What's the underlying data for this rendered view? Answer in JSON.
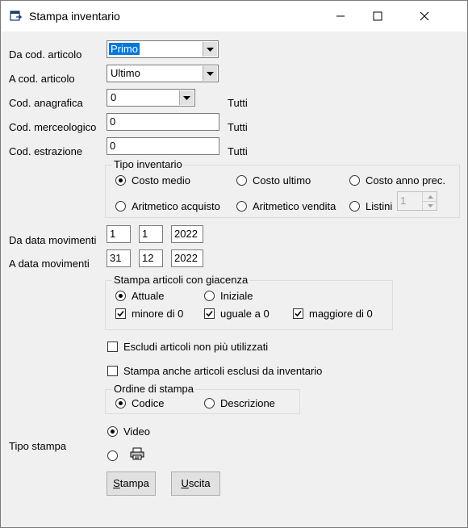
{
  "window": {
    "title": "Stampa inventario"
  },
  "fields": {
    "da_cod_articolo": {
      "label": "Da cod. articolo",
      "value": "Primo"
    },
    "a_cod_articolo": {
      "label": "A cod. articolo",
      "value": "Ultimo"
    },
    "cod_anagrafica": {
      "label": "Cod. anagrafica",
      "value": "0",
      "suffix": "Tutti"
    },
    "cod_merceologico": {
      "label": "Cod. merceologico",
      "value": "0",
      "suffix": "Tutti"
    },
    "cod_estrazione": {
      "label": "Cod. estrazione",
      "value": "0",
      "suffix": "Tutti"
    }
  },
  "tipo_inventario": {
    "title": "Tipo inventario",
    "options": [
      "Costo medio",
      "Costo ultimo",
      "Costo anno prec.",
      "Aritmetico acquisto",
      "Aritmetico vendita",
      "Listini"
    ],
    "selected": "Costo medio",
    "listini_value": "1"
  },
  "date": {
    "da_label": "Da data movimenti",
    "da_day": "1",
    "da_month": "1",
    "da_year": "2022",
    "a_label": "A data movimenti",
    "a_day": "31",
    "a_month": "12",
    "a_year": "2022"
  },
  "giacenza": {
    "title": "Stampa articoli con giacenza",
    "attuale": "Attuale",
    "iniziale": "Iniziale",
    "selected": "Attuale",
    "minore": "minore di 0",
    "uguale": "uguale a 0",
    "maggiore": "maggiore di 0"
  },
  "options": {
    "escludi": "Escludi articoli non più utilizzati",
    "stampa_esclusi": "Stampa anche articoli esclusi da inventario"
  },
  "ordine": {
    "title": "Ordine di stampa",
    "codice": "Codice",
    "descrizione": "Descrizione",
    "selected": "Codice"
  },
  "tipo_stampa": {
    "label": "Tipo stampa",
    "video": "Video",
    "selected": "Video"
  },
  "buttons": {
    "stampa_first": "S",
    "stampa_rest": "tampa",
    "uscita_first": "U",
    "uscita_rest": "scita"
  }
}
